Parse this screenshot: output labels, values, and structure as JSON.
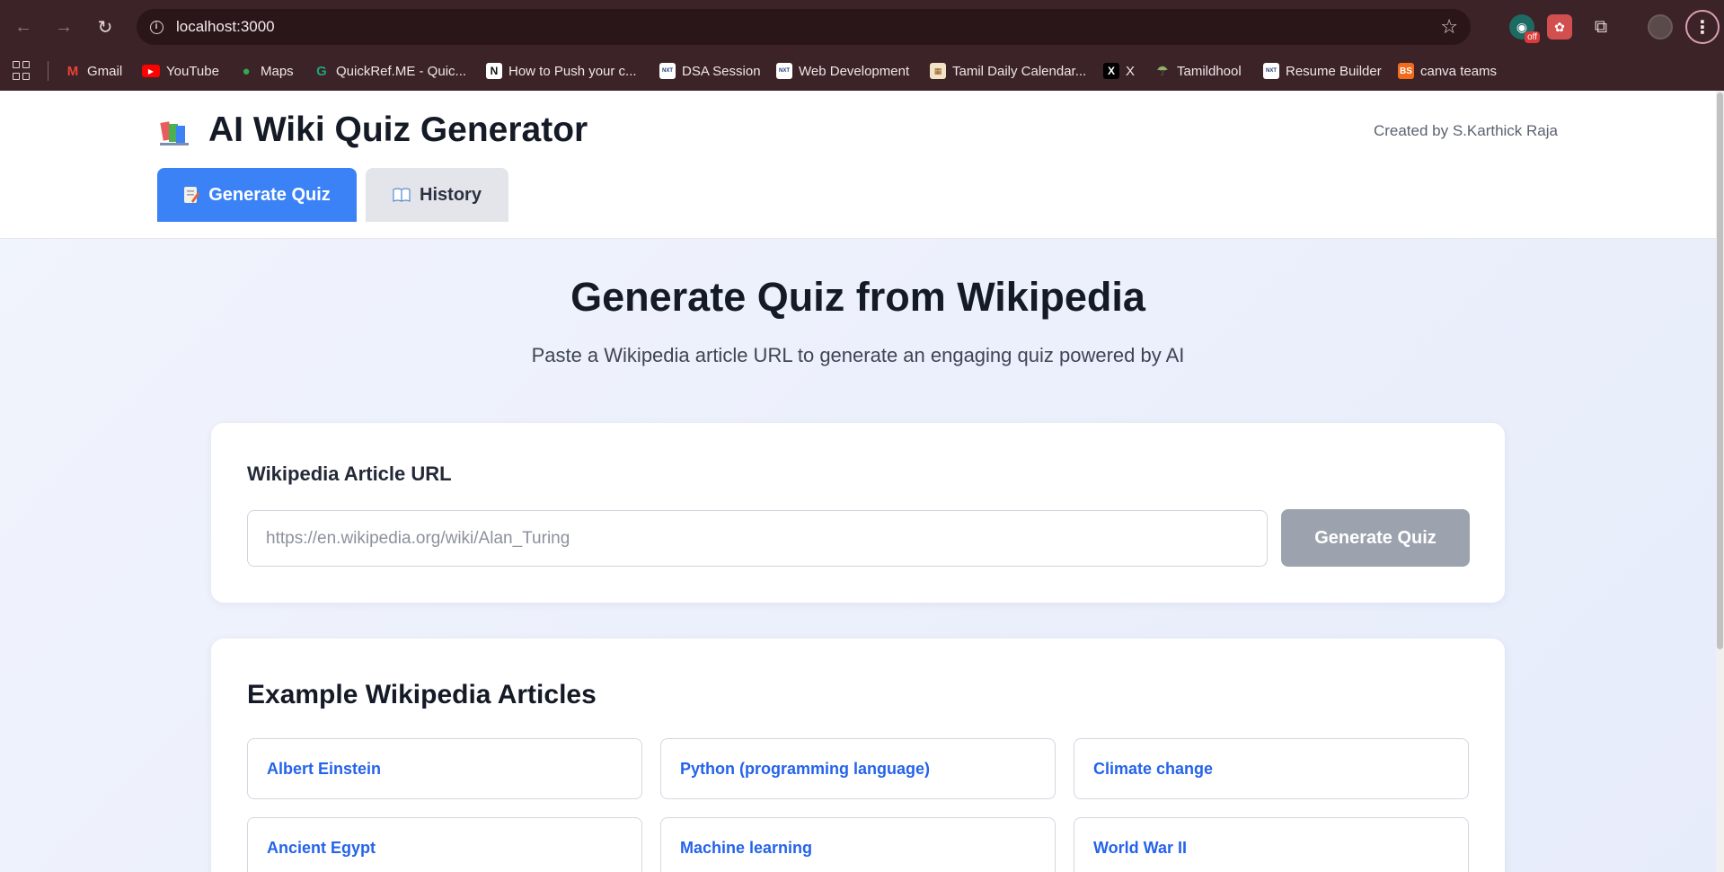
{
  "browser": {
    "url": "localhost:3000",
    "extensions": {
      "off_badge": "off"
    },
    "bookmarks": [
      {
        "label": "Gmail",
        "favicon": "gmail-icon",
        "color": "#ea4335"
      },
      {
        "label": "YouTube",
        "favicon": "youtube-icon",
        "color": "#ff0000"
      },
      {
        "label": "Maps",
        "favicon": "maps-icon",
        "color": "#34a853"
      },
      {
        "label": "QuickRef.ME - Quic...",
        "favicon": "quickref-icon",
        "color": "#1fa37a"
      },
      {
        "label": "How to Push your c...",
        "favicon": "notion-icon",
        "color": "#ffffff"
      },
      {
        "label": "DSA Session",
        "favicon": "nxtwave-icon",
        "color": "#ffffff"
      },
      {
        "label": "Web Development",
        "favicon": "nxtwave-icon",
        "color": "#ffffff"
      },
      {
        "label": "Tamil Daily Calendar...",
        "favicon": "calendar-icon",
        "color": "#f3e3c6"
      },
      {
        "label": "X",
        "favicon": "x-icon",
        "color": "#000000"
      },
      {
        "label": "Tamildhool",
        "favicon": "tamildhool-icon",
        "color": "#8fb36a"
      },
      {
        "label": "Resume Builder",
        "favicon": "nxtwave-icon",
        "color": "#ffffff"
      },
      {
        "label": "canva teams",
        "favicon": "bs-icon",
        "color": "#f26b1d"
      }
    ]
  },
  "header": {
    "title": "AI Wiki Quiz Generator",
    "created_by": "Created by S.Karthick Raja",
    "tabs": [
      {
        "label": "Generate Quiz",
        "active": true
      },
      {
        "label": "History",
        "active": false
      }
    ]
  },
  "hero": {
    "title": "Generate Quiz from Wikipedia",
    "subtitle": "Paste a Wikipedia article URL to generate an engaging quiz powered by AI"
  },
  "form": {
    "label": "Wikipedia Article URL",
    "value": "",
    "placeholder": "https://en.wikipedia.org/wiki/Alan_Turing",
    "button": "Generate Quiz"
  },
  "examples": {
    "title": "Example Wikipedia Articles",
    "items": [
      "Albert Einstein",
      "Python (programming language)",
      "Climate change",
      "Ancient Egypt",
      "Machine learning",
      "World War II"
    ]
  },
  "colors": {
    "accent": "#3b82f6",
    "link": "#2563eb",
    "button_disabled": "#9ca3ae",
    "browser_frame": "#3c2327"
  }
}
